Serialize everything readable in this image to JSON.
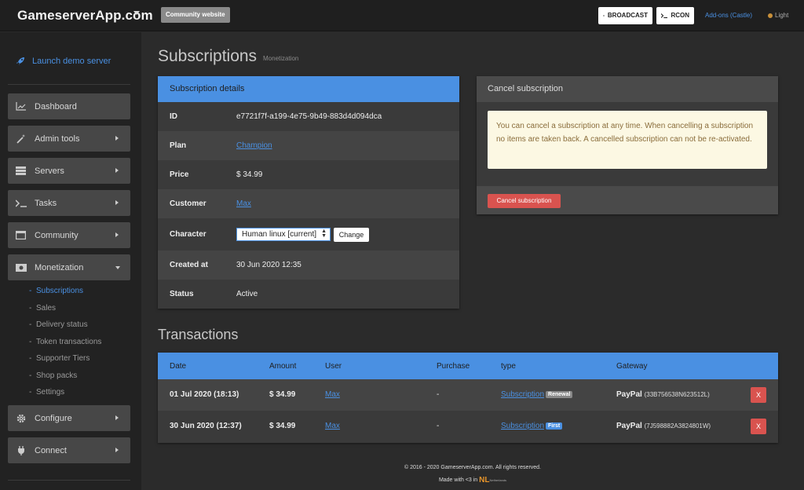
{
  "topbar": {
    "brand": "GameserverApp.com",
    "community_label": "Community website",
    "broadcast_label": "BROADCAST",
    "rcon_label": "RCON",
    "addons_label": "Add-ons (Castle)",
    "light_label": "Light"
  },
  "sidebar": {
    "launch_label": "Launch demo server",
    "items": [
      {
        "label": "Dashboard",
        "icon": "chart-icon"
      },
      {
        "label": "Admin tools",
        "icon": "wand-icon"
      },
      {
        "label": "Servers",
        "icon": "server-icon"
      },
      {
        "label": "Tasks",
        "icon": "terminal-icon"
      },
      {
        "label": "Community",
        "icon": "window-icon"
      },
      {
        "label": "Monetization",
        "icon": "money-icon"
      },
      {
        "label": "Configure",
        "icon": "gear-icon"
      },
      {
        "label": "Connect",
        "icon": "plug-icon"
      }
    ],
    "sub_items": [
      {
        "label": "Subscriptions",
        "active": true
      },
      {
        "label": "Sales"
      },
      {
        "label": "Delivery status"
      },
      {
        "label": "Token transactions"
      },
      {
        "label": "Supporter Tiers"
      },
      {
        "label": "Shop packs"
      },
      {
        "label": "Settings"
      }
    ]
  },
  "page": {
    "title": "Subscriptions",
    "subtitle": "Monetization"
  },
  "details": {
    "header": "Subscription details",
    "rows": {
      "id": {
        "label": "ID",
        "value": "e7721f7f-a199-4e75-9b49-883d4d094dca"
      },
      "plan": {
        "label": "Plan",
        "value": "Champion"
      },
      "price": {
        "label": "Price",
        "value": "$ 34.99"
      },
      "customer": {
        "label": "Customer",
        "value": "Max"
      },
      "character": {
        "label": "Character",
        "value": "Human linux [current]",
        "button": "Change"
      },
      "created": {
        "label": "Created at",
        "value": "30 Jun 2020 12:35"
      },
      "status": {
        "label": "Status",
        "value": "Active"
      }
    }
  },
  "cancel": {
    "header": "Cancel subscription",
    "warning": "You can cancel a subscription at any time. When cancelling a subscription no items are taken back. A cancelled subscription can not be re-activated.",
    "button": "Cancel subscription"
  },
  "transactions": {
    "title": "Transactions",
    "columns": [
      "Date",
      "Amount",
      "User",
      "Purchase",
      "type",
      "Gateway"
    ],
    "rows": [
      {
        "date": "01 Jul 2020 (18:13)",
        "amount": "$ 34.99",
        "user": "Max",
        "purchase": "-",
        "type": "Subscription",
        "badge": "Renewal",
        "gateway": "PayPal",
        "gateway_id": "(33B756538N623512L)",
        "action": "X"
      },
      {
        "date": "30 Jun 2020 (12:37)",
        "amount": "$ 34.99",
        "user": "Max",
        "purchase": "-",
        "type": "Subscription",
        "badge": "First",
        "gateway": "PayPal",
        "gateway_id": "(7J598882A3824801W)",
        "action": "X"
      }
    ]
  },
  "footer": {
    "copyright": "© 2016 - 2020 GameserverApp.com. All rights reserved.",
    "made_with": "Made with <3 in",
    "nl": "NL",
    "nl_sub": "Netherlands"
  },
  "colors": {
    "accent": "#4a90e2",
    "danger": "#d9534f",
    "warning_bg": "#fcf8e3"
  }
}
